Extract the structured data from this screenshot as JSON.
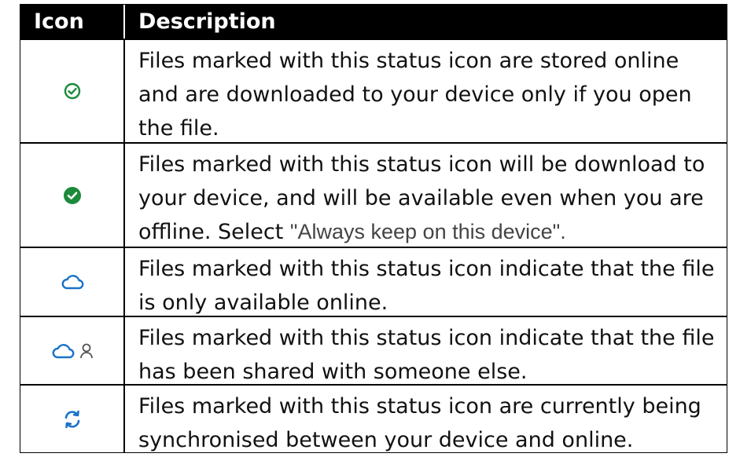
{
  "header": {
    "icon_col": "Icon",
    "desc_col": "Description"
  },
  "rows": [
    {
      "icon": "online-only-check-outline-icon",
      "desc": "Files marked with this status icon are stored online and are downloaded to your device only if you open the file."
    },
    {
      "icon": "always-available-check-filled-icon",
      "desc_prefix": "Files marked with this status icon will be download to your device, and will be available even when you are offline. Select ",
      "desc_quote": "\"Always keep on this device\".",
      "desc": ""
    },
    {
      "icon": "cloud-icon",
      "desc": "Files marked with this status icon indicate that the file is only available online."
    },
    {
      "icon": "cloud-shared-person-icon",
      "desc": "Files marked with this status icon indicate that the file has been shared with someone else."
    },
    {
      "icon": "sync-icon",
      "desc": "Files marked with this status icon are currently being synchronised between your device and online."
    }
  ],
  "colors": {
    "header_bg": "#000000",
    "check_green": "#1b8a3a",
    "cloud_blue": "#1a73c8",
    "person_gray": "#555555"
  }
}
